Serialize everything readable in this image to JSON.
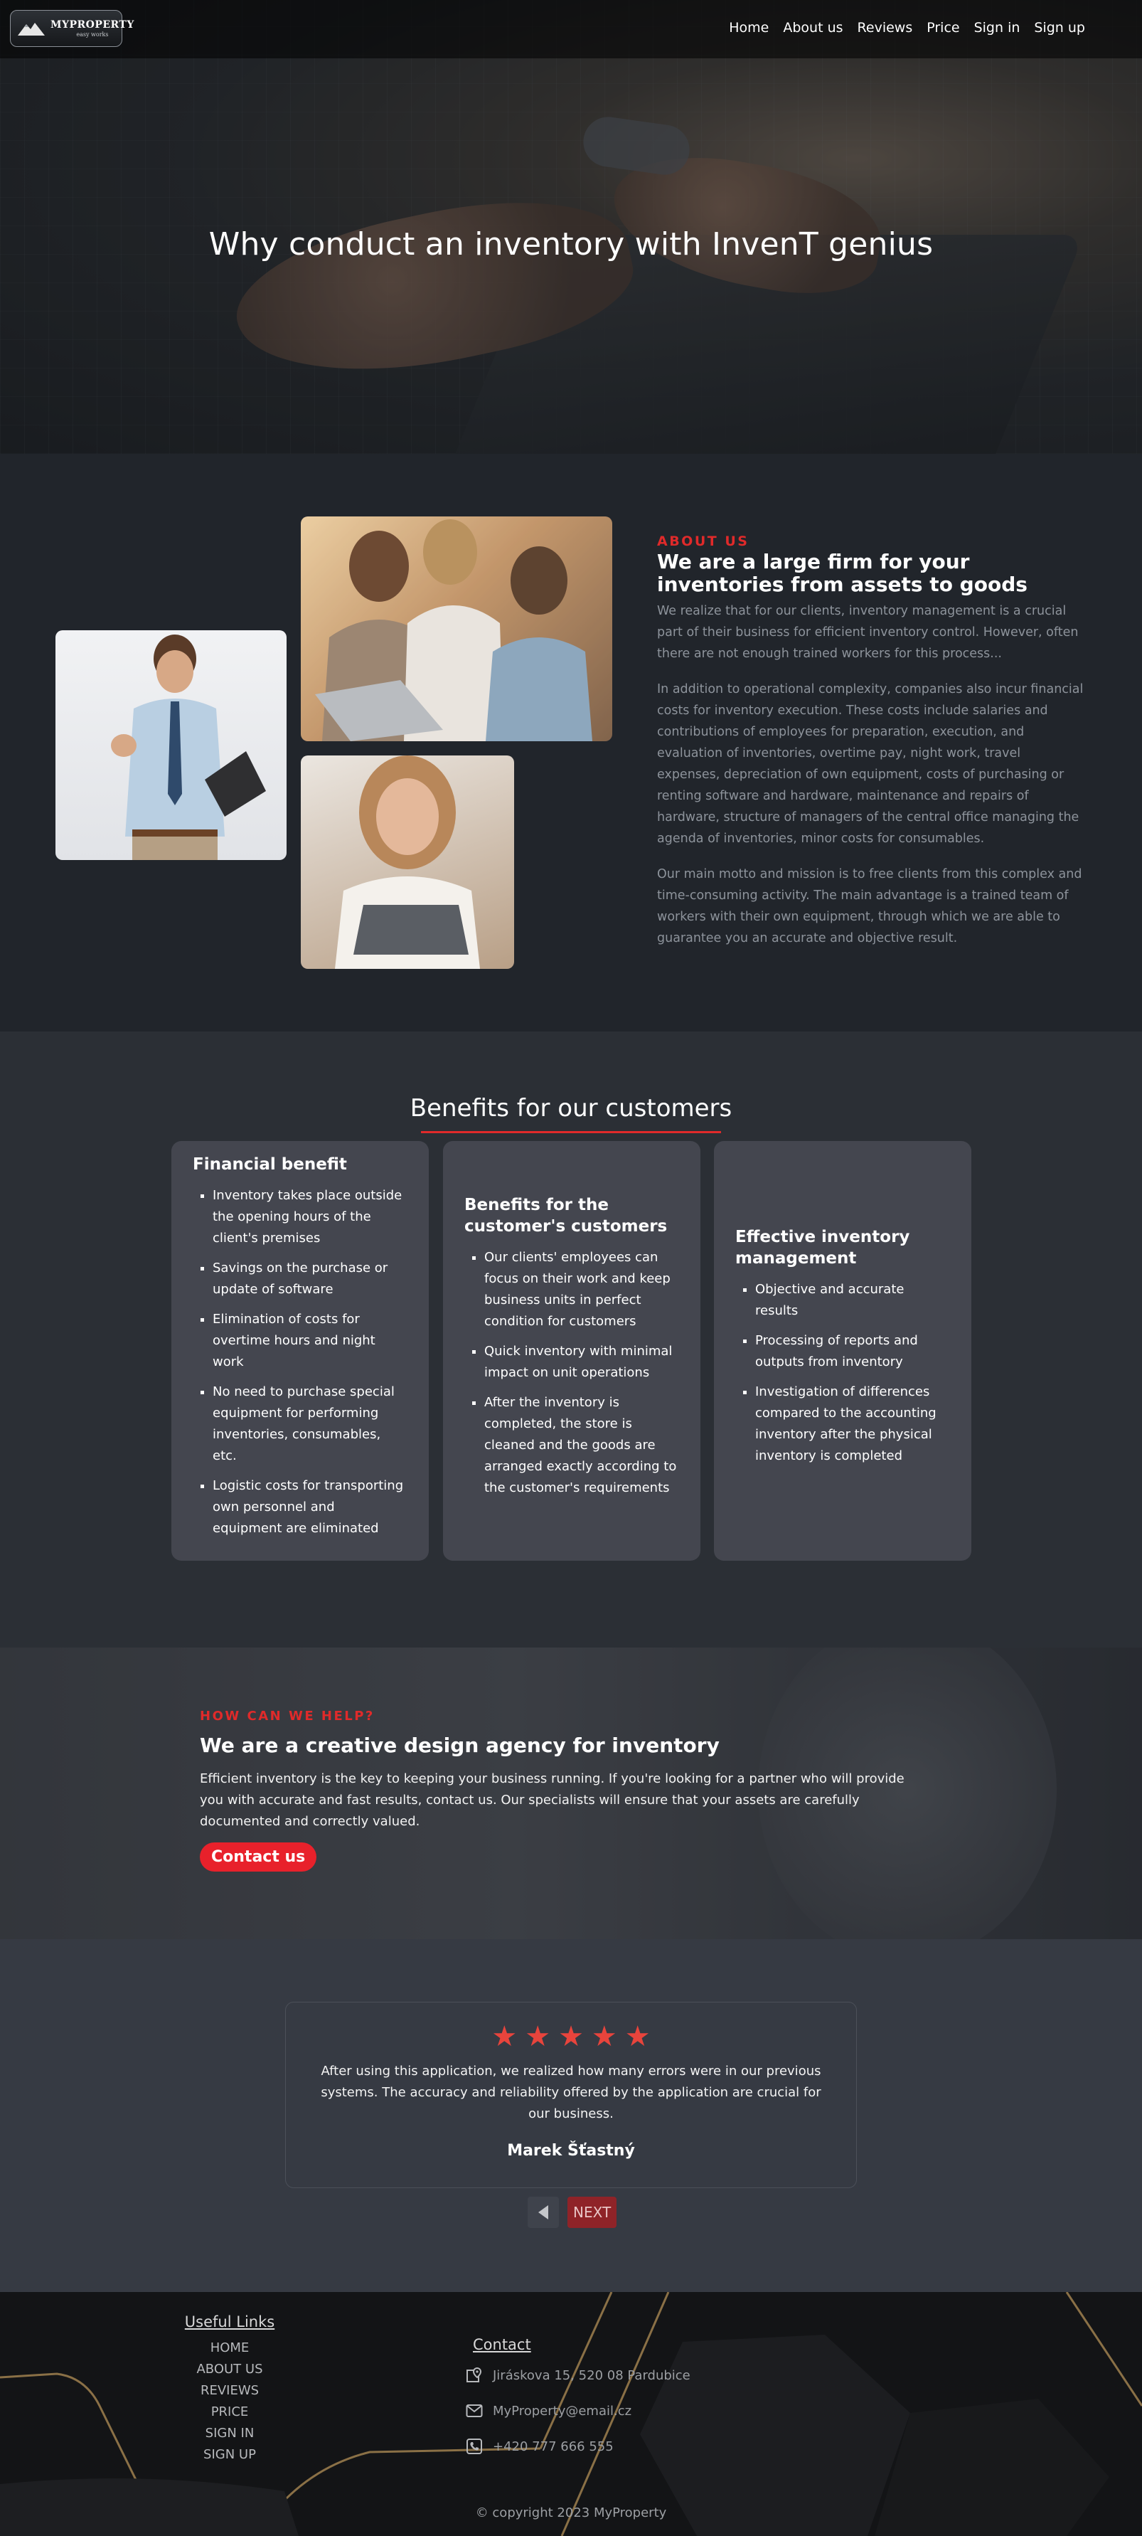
{
  "nav": {
    "logo_name": "MYPROPERTY",
    "logo_tagline": "easy works",
    "links": [
      "Home",
      "About us",
      "Reviews",
      "Price",
      "Sign in",
      "Sign up"
    ]
  },
  "hero": {
    "title": "Why conduct an inventory with InvenT genius"
  },
  "about": {
    "kicker": "ABOUT US",
    "heading": "We are a large firm for your inventories from assets to goods",
    "paragraphs": [
      "We realize that for our clients, inventory management is a crucial part of their business for efficient inventory control. However, often there are not enough trained workers for this process...",
      "In addition to operational complexity, companies also incur financial costs for inventory execution. These costs include salaries and contributions of employees for preparation, execution, and evaluation of inventories, overtime pay, night work, travel expenses, depreciation of own equipment, costs of purchasing or renting software and hardware, maintenance and repairs of hardware, structure of managers of the central office managing the agenda of inventories, minor costs for consumables.",
      "Our main motto and mission is to free clients from this complex and time-consuming activity. The main advantage is a trained team of workers with their own equipment, through which we are able to guarantee you an accurate and objective result."
    ]
  },
  "benefits": {
    "title": "Benefits for our customers",
    "cards": [
      {
        "title": "Financial benefit",
        "items": [
          "Inventory takes place outside the opening hours of the client's premises",
          "Savings on the purchase or update of software",
          "Elimination of costs for overtime hours and night work",
          "No need to purchase special equipment for performing inventories, consumables, etc.",
          "Logistic costs for transporting own personnel and equipment are eliminated"
        ]
      },
      {
        "title": "Benefits for the customer's customers",
        "items": [
          "Our clients' employees can focus on their work and keep business units in perfect condition for customers",
          "Quick inventory with minimal impact on unit operations",
          "After the inventory is completed, the store is cleaned and the goods are arranged exactly according to the customer's requirements"
        ]
      },
      {
        "title": "Effective inventory management",
        "items": [
          "Objective and accurate results",
          "Processing of reports and outputs from inventory",
          "Investigation of differences compared to the accounting inventory after the physical inventory is completed"
        ]
      }
    ]
  },
  "help": {
    "kicker": "HOW CAN WE HELP?",
    "heading": "We are a creative design agency for inventory",
    "text": "Efficient inventory is the key to keeping your business running. If you're looking for a partner who will provide you with accurate and fast results, contact us. Our specialists will ensure that your assets are carefully documented and correctly valued.",
    "button": "Contact us"
  },
  "testimonial": {
    "rating": 5,
    "quote": "After using this application, we realized how many errors were in our previous systems. The accuracy and reliability offered by the application are crucial for our business.",
    "author": "Marek Šťastný",
    "next_label": "NEXT"
  },
  "footer": {
    "links_title": "Useful Links",
    "links": [
      "HOME",
      "ABOUT US",
      "REVIEWS",
      "PRICE",
      "SIGN IN",
      "SIGN UP"
    ],
    "contact_title": "Contact",
    "address": "Jiráskova 15, 520 08 Pardubice",
    "email": "MyProperty@email.cz",
    "phone": "+420 777 666 555",
    "copyright": "© copyright 2023 MyProperty"
  },
  "colors": {
    "accent": "#e02a2a",
    "button": "#e8212b",
    "card": "#44464f",
    "page": "#21252b"
  },
  "icons": {
    "address": "map-pin-icon",
    "email": "envelope-icon",
    "phone": "phone-icon",
    "prev": "triangle-left-icon",
    "star": "star-icon"
  }
}
